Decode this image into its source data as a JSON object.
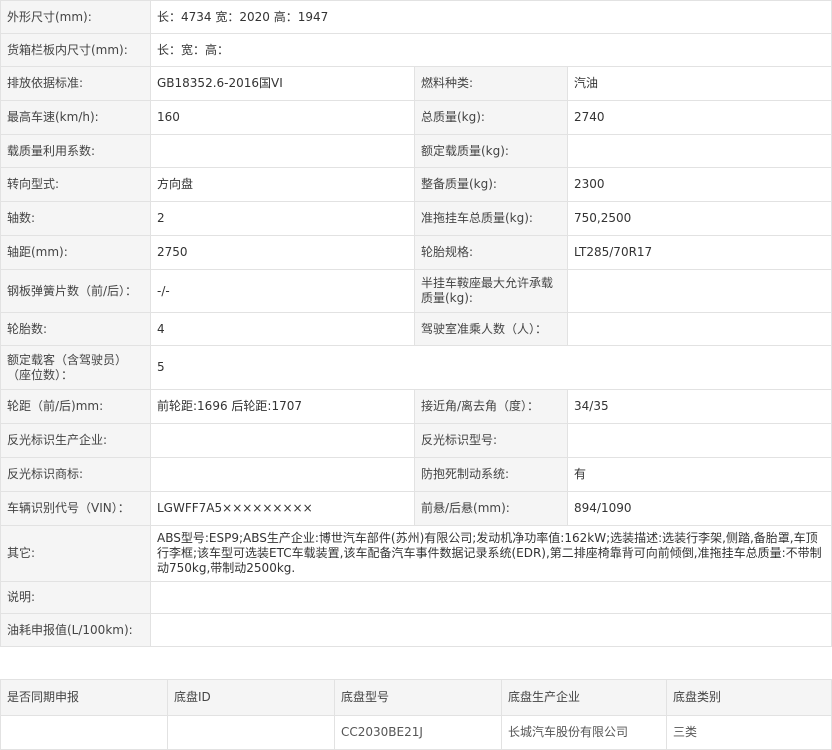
{
  "spec_rows": [
    {
      "type": "wide",
      "label": "外形尺寸(mm):",
      "value": "长：4734 宽：2020 高：1947"
    },
    {
      "type": "wide",
      "label": "货箱栏板内尺寸(mm):",
      "value": "长：宽：高："
    },
    {
      "type": "pair",
      "label1": "排放依据标准:",
      "value1": "GB18352.6-2016国VI",
      "label2": "燃料种类:",
      "value2": "汽油"
    },
    {
      "type": "pair",
      "label1": "最高车速(km/h):",
      "value1": "160",
      "label2": "总质量(kg):",
      "value2": "2740"
    },
    {
      "type": "pair",
      "label1": "载质量利用系数:",
      "value1": "",
      "label2": "额定载质量(kg):",
      "value2": ""
    },
    {
      "type": "pair",
      "label1": "转向型式:",
      "value1": "方向盘",
      "label2": "整备质量(kg):",
      "value2": "2300"
    },
    {
      "type": "pair",
      "label1": "轴数:",
      "value1": "2",
      "label2": "准拖挂车总质量(kg):",
      "value2": "750,2500"
    },
    {
      "type": "pair",
      "label1": "轴距(mm):",
      "value1": "2750",
      "label2": "轮胎规格:",
      "value2": "LT285/70R17"
    },
    {
      "type": "pair",
      "label1": "钢板弹簧片数（前/后）：",
      "value1": "-/-",
      "label2": "半挂车鞍座最大允许承载质量(kg):",
      "value2": ""
    },
    {
      "type": "pair",
      "label1": "轮胎数:",
      "value1": "4",
      "label2": "驾驶室准乘人数（人）：",
      "value2": ""
    },
    {
      "type": "wide",
      "label": "额定载客（含驾驶员）（座位数）：",
      "value": "5"
    },
    {
      "type": "pair",
      "label1": "轮距（前/后)mm:",
      "value1": "前轮距:1696 后轮距:1707",
      "label2": "接近角/离去角（度）：",
      "value2": "34/35"
    },
    {
      "type": "pair",
      "label1": "反光标识生产企业:",
      "value1": "",
      "label2": "反光标识型号:",
      "value2": ""
    },
    {
      "type": "pair",
      "label1": "反光标识商标:",
      "value1": "",
      "label2": "防抱死制动系统:",
      "value2": "有"
    },
    {
      "type": "pair",
      "label1": "车辆识别代号（VIN）：",
      "value1": "LGWFF7A5×××××××××",
      "label2": "前悬/后悬(mm):",
      "value2": "894/1090"
    },
    {
      "type": "wide",
      "label": "其它:",
      "value": "ABS型号:ESP9;ABS生产企业:博世汽车部件(苏州)有限公司;发动机净功率值:162kW;选装描述:选装行李架,侧踏,备胎罩,车顶行李框;该车型可选装ETC车载装置,该车配备汽车事件数据记录系统(EDR),第二排座椅靠背可向前倾倒,准拖挂车总质量:不带制动750kg,带制动2500kg."
    },
    {
      "type": "wide",
      "label": "说明:",
      "value": ""
    },
    {
      "type": "wide",
      "label": "油耗申报值(L/100km):",
      "value": ""
    }
  ],
  "chassis": {
    "headers": [
      "是否同期申报",
      "底盘ID",
      "底盘型号",
      "底盘生产企业",
      "底盘类别"
    ],
    "rows": [
      [
        "",
        "",
        "CC2030BE21J",
        "长城汽车股份有限公司",
        "三类"
      ]
    ]
  }
}
